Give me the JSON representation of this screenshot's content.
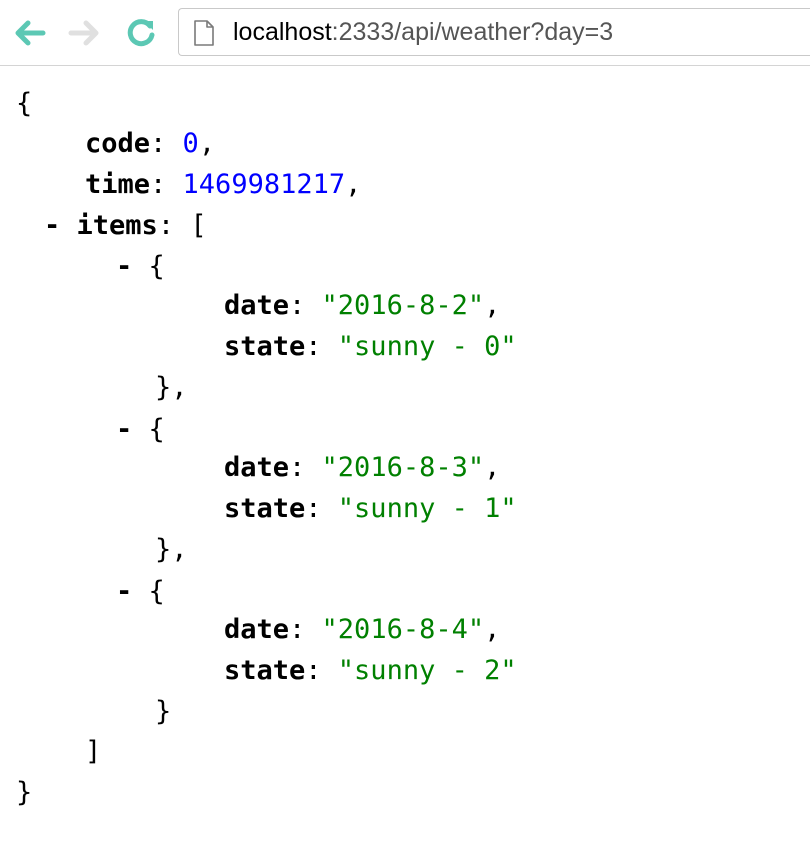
{
  "browser": {
    "url": {
      "host": "localhost",
      "rest": ":2333/api/weather?day=3"
    },
    "icons": {
      "back": "arrow-left-icon",
      "forward": "arrow-right-icon",
      "reload": "reload-icon",
      "page": "page-icon"
    },
    "colors": {
      "nav_active": "#5cc8b4",
      "nav_disabled": "#e0e0e0"
    }
  },
  "json_view": {
    "open_brace": "{",
    "close_brace": "}",
    "code_key": "code",
    "code_value": "0",
    "time_key": "time",
    "time_value": "1469981217",
    "items_key": "items",
    "items_open": "[",
    "items_close": "]",
    "collapse_symbol": "-",
    "items": [
      {
        "date_key": "date",
        "date_value": "\"2016-8-2\"",
        "state_key": "state",
        "state_value": "\"sunny - 0\""
      },
      {
        "date_key": "date",
        "date_value": "\"2016-8-3\"",
        "state_key": "state",
        "state_value": "\"sunny - 1\""
      },
      {
        "date_key": "date",
        "date_value": "\"2016-8-4\"",
        "state_key": "state",
        "state_value": "\"sunny - 2\""
      }
    ],
    "colors": {
      "number": "#0000ff",
      "string": "#008000",
      "key": "#000000"
    }
  }
}
